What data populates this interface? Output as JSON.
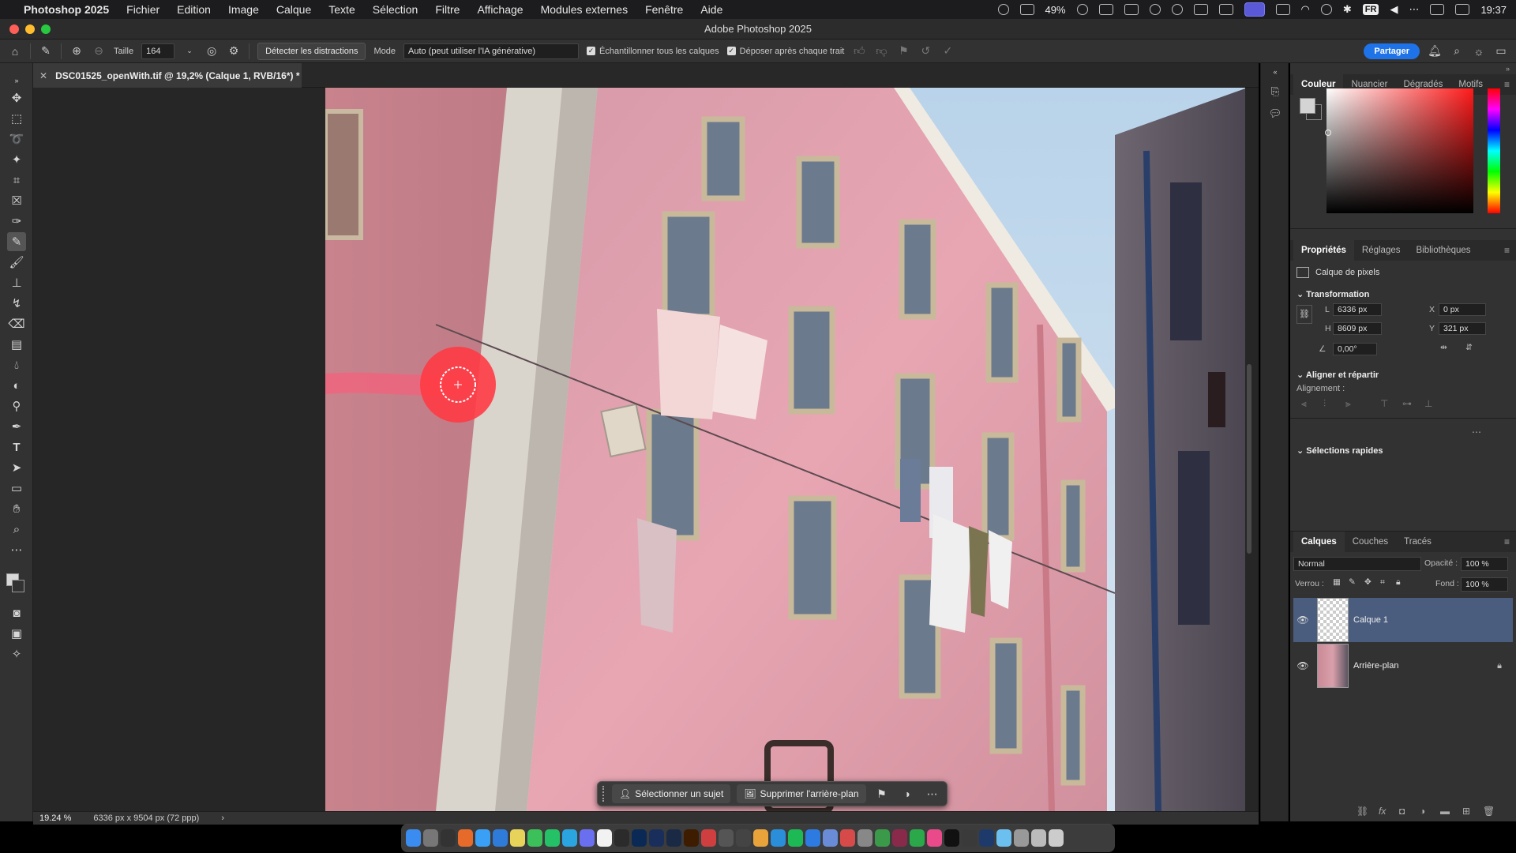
{
  "menubar": {
    "app_name": "Photoshop 2025",
    "items": [
      "Fichier",
      "Edition",
      "Image",
      "Calque",
      "Texte",
      "Sélection",
      "Filtre",
      "Affichage",
      "Modules externes",
      "Fenêtre",
      "Aide"
    ],
    "battery": "49%",
    "lang": "FR",
    "time": "19:37"
  },
  "window": {
    "title": "Adobe Photoshop 2025"
  },
  "options_bar": {
    "size_label": "Taille",
    "size_value": "164",
    "detect_button": "Détecter les distractions",
    "mode_label": "Mode",
    "mode_value": "Auto (peut utiliser l'IA générative)",
    "sample_all_label": "Échantillonner tous les calques",
    "drop_after_label": "Déposer après chaque trait",
    "share_button": "Partager"
  },
  "document": {
    "tab_title": "DSC01525_openWith.tif @ 19,2% (Calque 1, RVB/16*) *",
    "zoom": "19.24 %",
    "dimensions": "6336 px x 9504 px (72 ppp)"
  },
  "taskbar": {
    "select_subject": "Sélectionner un sujet",
    "remove_background": "Supprimer l'arrière-plan"
  },
  "color_panel": {
    "tabs": [
      "Couleur",
      "Nuancier",
      "Dégradés",
      "Motifs"
    ],
    "fg_color": "#d4d4d4"
  },
  "properties_panel": {
    "tabs": [
      "Propriétés",
      "Réglages",
      "Bibliothèques"
    ],
    "layer_type": "Calque de pixels",
    "transform_title": "Transformation",
    "w_label": "L",
    "w_value": "6336 px",
    "h_label": "H",
    "h_value": "8609 px",
    "x_label": "X",
    "x_value": "0 px",
    "y_label": "Y",
    "y_value": "321 px",
    "angle_value": "0,00°",
    "align_title": "Aligner et répartir",
    "align_label": "Alignement :",
    "quick_title": "Sélections rapides"
  },
  "layers_panel": {
    "tabs": [
      "Calques",
      "Couches",
      "Tracés"
    ],
    "blend_mode": "Normal",
    "opacity_label": "Opacité :",
    "opacity_value": "100 %",
    "lock_label": "Verrou :",
    "fill_label": "Fond :",
    "fill_value": "100 %",
    "layers": [
      {
        "name": "Calque 1",
        "selected": true
      },
      {
        "name": "Arrière-plan",
        "selected": false,
        "locked": true
      }
    ]
  },
  "colors": {
    "accent": "#1f73e8",
    "brush_cursor": "#ff3b45",
    "wall_pink": "#e8a0a8"
  }
}
